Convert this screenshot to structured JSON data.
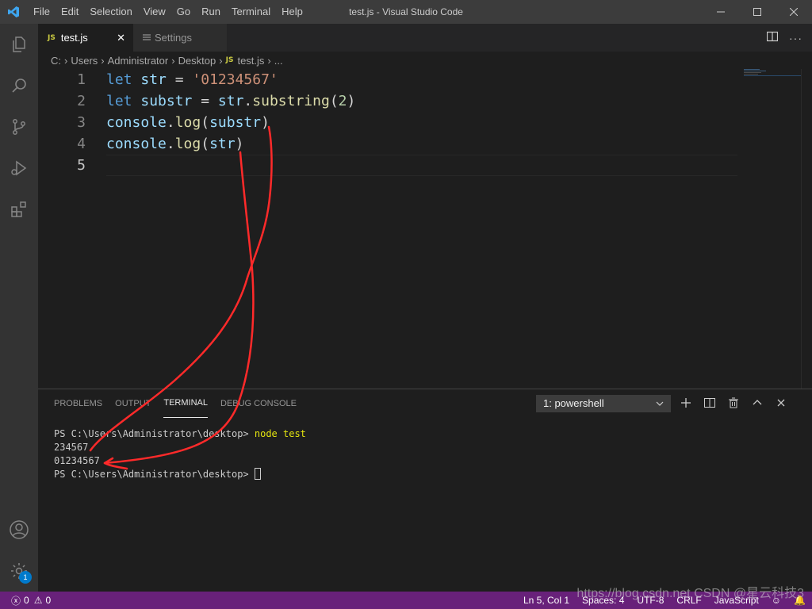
{
  "window": {
    "title": "test.js - Visual Studio Code",
    "menu": [
      "File",
      "Edit",
      "Selection",
      "View",
      "Go",
      "Run",
      "Terminal",
      "Help"
    ]
  },
  "activity_bar": {
    "items": [
      "explorer-icon",
      "search-icon",
      "source-control-icon",
      "run-debug-icon",
      "extensions-icon"
    ],
    "bottom": [
      "account-icon",
      "manage-gear-icon"
    ],
    "manage_badge": "1"
  },
  "tabs": [
    {
      "icon": "JS",
      "label": "test.js",
      "active": true
    },
    {
      "icon": "settings-icon",
      "label": "Settings",
      "active": false
    }
  ],
  "breadcrumb": {
    "parts": [
      "C:",
      "Users",
      "Administrator",
      "Desktop"
    ],
    "file_icon": "JS",
    "file": "test.js",
    "more": "..."
  },
  "editor": {
    "line_numbers": [
      "1",
      "2",
      "3",
      "4",
      "5"
    ],
    "current_line": 5,
    "lines": [
      [
        {
          "t": "let",
          "c": "kw"
        },
        {
          "t": " ",
          "c": "op"
        },
        {
          "t": "str",
          "c": "var"
        },
        {
          "t": " = ",
          "c": "op"
        },
        {
          "t": "'01234567'",
          "c": "str"
        }
      ],
      [
        {
          "t": "let",
          "c": "kw"
        },
        {
          "t": " ",
          "c": "op"
        },
        {
          "t": "substr",
          "c": "var"
        },
        {
          "t": " = ",
          "c": "op"
        },
        {
          "t": "str",
          "c": "var"
        },
        {
          "t": ".",
          "c": "op"
        },
        {
          "t": "substring",
          "c": "fn"
        },
        {
          "t": "(",
          "c": "op"
        },
        {
          "t": "2",
          "c": "num"
        },
        {
          "t": ")",
          "c": "op"
        }
      ],
      [
        {
          "t": "console",
          "c": "var"
        },
        {
          "t": ".",
          "c": "op"
        },
        {
          "t": "log",
          "c": "fn"
        },
        {
          "t": "(",
          "c": "op"
        },
        {
          "t": "substr",
          "c": "var"
        },
        {
          "t": ")",
          "c": "op"
        }
      ],
      [
        {
          "t": "console",
          "c": "var"
        },
        {
          "t": ".",
          "c": "op"
        },
        {
          "t": "log",
          "c": "fn"
        },
        {
          "t": "(",
          "c": "op"
        },
        {
          "t": "str",
          "c": "var"
        },
        {
          "t": ")",
          "c": "op"
        }
      ],
      []
    ]
  },
  "panel": {
    "tabs": [
      "PROBLEMS",
      "OUTPUT",
      "TERMINAL",
      "DEBUG CONSOLE"
    ],
    "active_tab": "TERMINAL",
    "terminal_select": "1: powershell",
    "actions": [
      "add-icon",
      "split-icon",
      "trash-icon",
      "chevron-up-icon",
      "close-icon"
    ],
    "terminal": {
      "prompt": "PS C:\\Users\\Administrator\\desktop> ",
      "command": "node test",
      "output": [
        "234567",
        "01234567"
      ],
      "prompt2": "PS C:\\Users\\Administrator\\desktop> "
    }
  },
  "status": {
    "errors": "0",
    "warnings": "0",
    "position": "Ln 5, Col 1",
    "spaces": "Spaces: 4",
    "encoding": "UTF-8",
    "eol": "CRLF",
    "language": "JavaScript"
  },
  "watermark": "https://blog.csdn.net CSDN @星云科技3",
  "colors": {
    "status_bar": "#68217a",
    "annotation": "#ff2a2a",
    "keyword": "#569cd6",
    "variable": "#9cdcfe",
    "function": "#dcdcaa",
    "string": "#ce9178",
    "number": "#b5cea8"
  }
}
